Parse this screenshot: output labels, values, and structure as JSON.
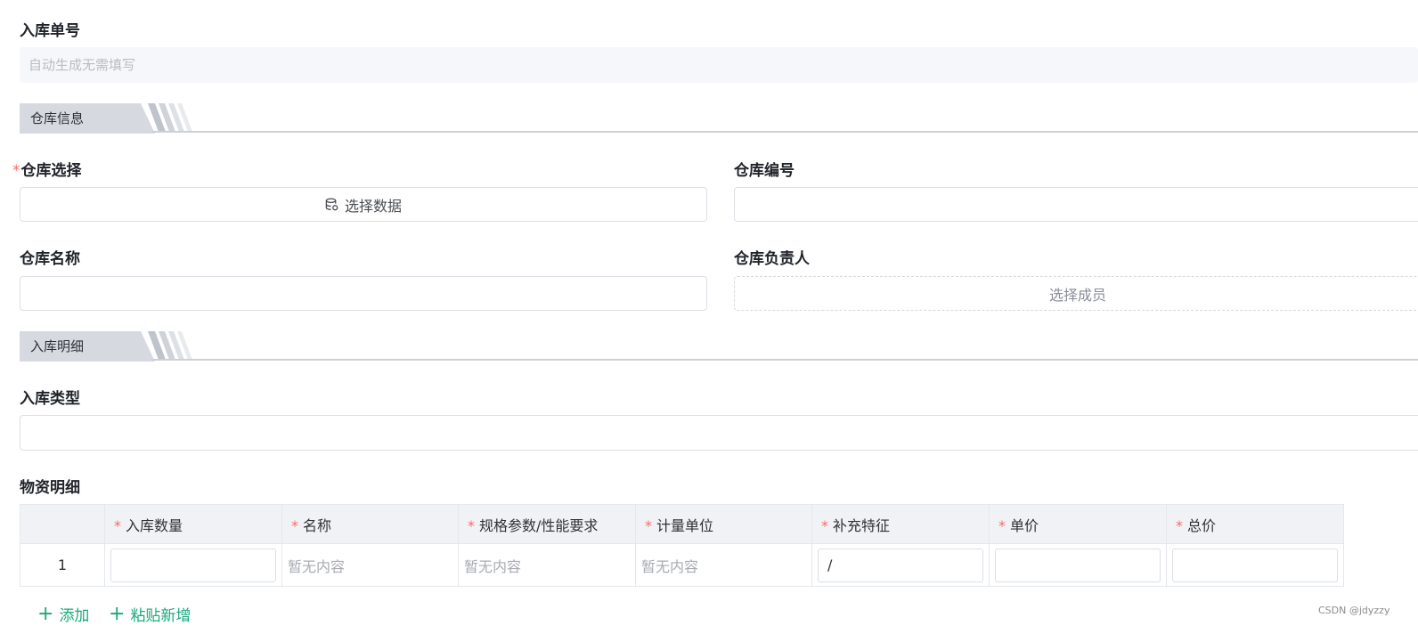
{
  "inbound_no": {
    "label": "入库单号",
    "placeholder": "自动生成无需填写"
  },
  "warehouse_section": {
    "title": "仓库信息"
  },
  "warehouse_select": {
    "required_mark": "*",
    "label": "仓库选择",
    "button_label": "选择数据",
    "icon": "database-icon"
  },
  "warehouse_code": {
    "label": "仓库编号",
    "value": ""
  },
  "warehouse_name": {
    "label": "仓库名称",
    "value": ""
  },
  "warehouse_manager": {
    "label": "仓库负责人",
    "button_label": "选择成员"
  },
  "detail_section": {
    "title": "入库明细"
  },
  "inbound_type": {
    "label": "入库类型",
    "value": ""
  },
  "materials": {
    "label": "物资明细",
    "required_mark": "*",
    "columns": [
      "入库数量",
      "名称",
      "规格参数/性能要求",
      "计量单位",
      "补充特征",
      "单价",
      "总价"
    ],
    "rows": [
      {
        "index": "1",
        "quantity": "",
        "name": "暂无内容",
        "spec": "暂无内容",
        "unit": "暂无内容",
        "feature": "/",
        "unit_price": "",
        "total_price": ""
      }
    ],
    "add_label": "添加",
    "paste_label": "粘贴新增"
  },
  "watermark": "CSDN @jdyzzy",
  "colors": {
    "accent": "#19a97b",
    "required": "#f56c6c",
    "section_bg": "#d6dae0"
  }
}
